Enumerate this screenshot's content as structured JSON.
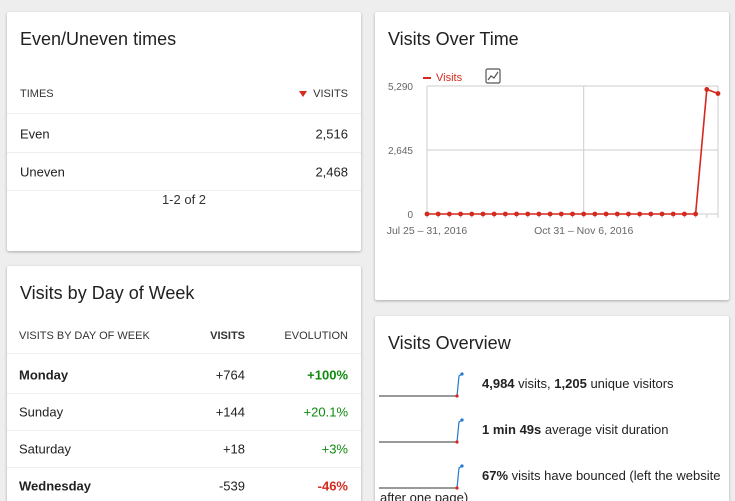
{
  "even_uneven": {
    "title": "Even/Uneven times",
    "col_times": "TIMES",
    "col_visits": "VISITS",
    "rows": [
      {
        "label": "Even",
        "visits": "2,516"
      },
      {
        "label": "Uneven",
        "visits": "2,468"
      }
    ],
    "pager": "1-2 of 2"
  },
  "day_of_week": {
    "title": "Visits by Day of Week",
    "col_day": "VISITS BY DAY OF WEEK",
    "col_visits": "VISITS",
    "col_evolution": "EVOLUTION",
    "rows": [
      {
        "day": "Monday",
        "visits": "+764",
        "evolution": "+100%",
        "trend": "up",
        "bold": true
      },
      {
        "day": "Sunday",
        "visits": "+144",
        "evolution": "+20.1%",
        "trend": "up",
        "bold": false
      },
      {
        "day": "Saturday",
        "visits": "+18",
        "evolution": "+3%",
        "trend": "up",
        "bold": false
      },
      {
        "day": "Wednesday",
        "visits": "-539",
        "evolution": "-46%",
        "trend": "down",
        "bold": true
      }
    ]
  },
  "visits_over_time": {
    "title": "Visits Over Time",
    "legend_label": "Visits",
    "chart_icon": "line-chart-icon"
  },
  "chart_data": {
    "type": "line",
    "title": "Visits Over Time",
    "xlabel": "",
    "ylabel": "",
    "y_ticks": [
      "5,290",
      "2,645",
      "0"
    ],
    "ylim": [
      0,
      5290
    ],
    "x_tick_labels": [
      "Jul 25 – 31, 2016",
      "Oct 31 – Nov 6, 2016"
    ],
    "x_tick_positions": [
      0,
      14
    ],
    "grid": true,
    "legend": "top-left",
    "series": [
      {
        "name": "Visits",
        "color": "#d4291f",
        "values": [
          0,
          0,
          0,
          0,
          0,
          0,
          0,
          0,
          0,
          0,
          0,
          0,
          0,
          0,
          0,
          0,
          0,
          0,
          0,
          0,
          0,
          0,
          0,
          0,
          0,
          5150,
          4980
        ]
      }
    ]
  },
  "overview": {
    "title": "Visits Overview",
    "items": [
      {
        "b1": "4,984",
        "t1": " visits, ",
        "b2": "1,205",
        "t2": " unique visitors"
      },
      {
        "b1": "1 min 49s",
        "t1": " average visit duration",
        "b2": "",
        "t2": ""
      },
      {
        "b1": "67%",
        "t1": " visits have bounced (left the website",
        "b2": "",
        "t2": ""
      }
    ],
    "wrap_text": "after one page)"
  },
  "colors": {
    "accent": "#d4291f",
    "positive": "#0f8a0f",
    "negative": "#d4291f",
    "spark_line": "#1f78d1"
  }
}
